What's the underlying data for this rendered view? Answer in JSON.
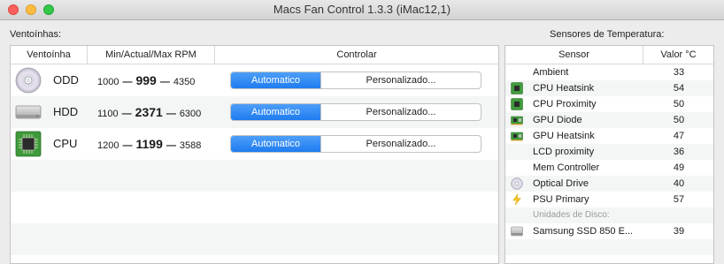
{
  "window": {
    "title": "Macs Fan Control 1.3.3 (iMac12,1)"
  },
  "fans_section": {
    "label": "Ventoínhas:",
    "columns": {
      "fan": "Ventoínha",
      "rpm": "Min/Actual/Max RPM",
      "control": "Controlar"
    },
    "rows": [
      {
        "name": "ODD",
        "icon": "disc-icon",
        "min": "1000",
        "current": "999",
        "max": "4350",
        "auto_label": "Automatico",
        "custom_label": "Personalizado..."
      },
      {
        "name": "HDD",
        "icon": "hard-drive-icon",
        "min": "1100",
        "current": "2371",
        "max": "6300",
        "auto_label": "Automatico",
        "custom_label": "Personalizado..."
      },
      {
        "name": "CPU",
        "icon": "cpu-chip-icon",
        "min": "1200",
        "current": "1199",
        "max": "3588",
        "auto_label": "Automatico",
        "custom_label": "Personalizado..."
      }
    ]
  },
  "sensors_section": {
    "label": "Sensores de Temperatura:",
    "columns": {
      "sensor": "Sensor",
      "value": "Valor °C"
    },
    "rows": [
      {
        "name": "Ambient",
        "value": "33",
        "icon": ""
      },
      {
        "name": "CPU Heatsink",
        "value": "54",
        "icon": "cpu-chip-icon"
      },
      {
        "name": "CPU Proximity",
        "value": "50",
        "icon": "cpu-chip-icon"
      },
      {
        "name": "GPU Diode",
        "value": "50",
        "icon": "gpu-card-icon"
      },
      {
        "name": "GPU Heatsink",
        "value": "47",
        "icon": "gpu-card-icon"
      },
      {
        "name": "LCD proximity",
        "value": "36",
        "icon": ""
      },
      {
        "name": "Mem Controller",
        "value": "49",
        "icon": ""
      },
      {
        "name": "Optical Drive",
        "value": "40",
        "icon": "disc-icon"
      },
      {
        "name": "PSU Primary",
        "value": "57",
        "icon": "lightning-icon"
      }
    ],
    "disk_subheading": "Unidades de Disco:",
    "disk_rows": [
      {
        "name": "Samsung SSD 850 E...",
        "value": "39",
        "icon": "hard-drive-icon"
      }
    ]
  },
  "colors": {
    "accent": "#1f7cf0",
    "row_alt": "#f4f5f5"
  }
}
